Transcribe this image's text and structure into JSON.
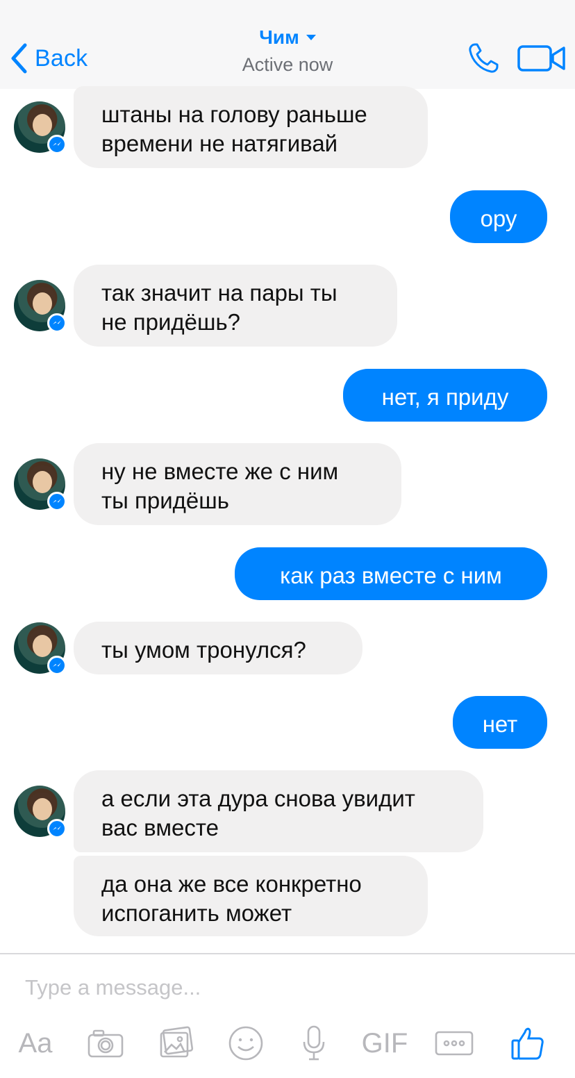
{
  "header": {
    "back_label": "Back",
    "contact_name": "Чим",
    "status": "Active now"
  },
  "colors": {
    "accent": "#0084ff",
    "incoming_bubble": "#f1f0f0",
    "outgoing_bubble": "#0084ff",
    "header_bg": "#f7f7f8"
  },
  "messages": [
    {
      "side": "in",
      "text": "штаны на голову раньше\nвремени не натягивай"
    },
    {
      "side": "out",
      "text": "ору"
    },
    {
      "side": "in",
      "text": "так значит на пары ты\nне придёшь?"
    },
    {
      "side": "out",
      "text": "нет, я приду"
    },
    {
      "side": "in",
      "text": "ну не вместе же с ним\nты придёшь"
    },
    {
      "side": "out",
      "text": "как раз вместе с ним"
    },
    {
      "side": "in",
      "text": "ты умом тронулся?"
    },
    {
      "side": "out",
      "text": "нет"
    },
    {
      "side": "in",
      "text": "а если эта дура снова увидит\nвас вместе"
    },
    {
      "side": "in",
      "text": "да она же все конкретно\nиспоганить может"
    }
  ],
  "composer": {
    "placeholder": "Type a message...",
    "text_tool_label": "Aa",
    "gif_label": "GIF",
    "icons": [
      "camera-icon",
      "gallery-icon",
      "emoji-icon",
      "microphone-icon",
      "more-icon",
      "like-icon"
    ]
  }
}
